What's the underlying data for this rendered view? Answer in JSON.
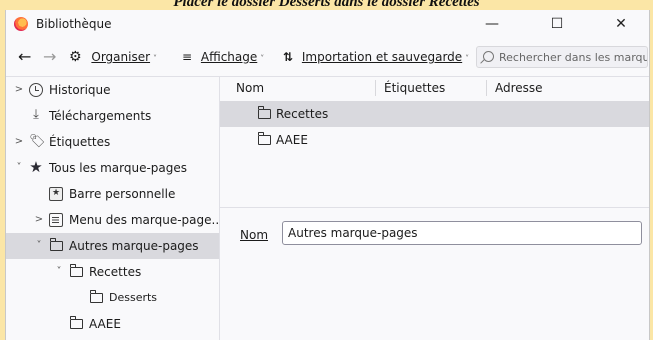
{
  "caption": "Placer le dossier Desserts dans le dossier Recettes",
  "window": {
    "title": "Bibliothèque",
    "minimize": "—",
    "maximize": "☐",
    "close": "✕"
  },
  "toolbar": {
    "back": "←",
    "forward": "→",
    "organize": {
      "icon": "⚙",
      "label": "Organiser"
    },
    "view": {
      "icon": "≡",
      "label": "Affichage"
    },
    "import": {
      "icon": "⇅",
      "label": "Importation et sauvegarde"
    },
    "caret": "˅",
    "search_placeholder": "Rechercher dans les marque-pages"
  },
  "sidebar": {
    "items": [
      {
        "label": "Historique",
        "twisty": ">",
        "icon": "clock-icon"
      },
      {
        "label": "Téléchargements",
        "twisty": "",
        "icon": "download-icon",
        "glyph": "⤓"
      },
      {
        "label": "Étiquettes",
        "twisty": ">",
        "icon": "tag-icon",
        "glyph": "🏷"
      },
      {
        "label": "Tous les marque-pages",
        "twisty": "˅",
        "icon": "star-icon",
        "glyph": "★"
      },
      {
        "label": "Barre personnelle",
        "twisty": "",
        "icon": "bookmarks-toolbar-icon",
        "glyph": "★"
      },
      {
        "label": "Menu des marque-page...",
        "twisty": ">",
        "icon": "bookmarks-menu-icon"
      },
      {
        "label": "Autres marque-pages",
        "twisty": "˅",
        "icon": "folder-icon"
      },
      {
        "label": "Recettes",
        "twisty": "˅",
        "icon": "folder-icon"
      },
      {
        "label": "Desserts",
        "twisty": "",
        "icon": "folder-icon"
      },
      {
        "label": "AAEE",
        "twisty": "",
        "icon": "folder-icon"
      }
    ]
  },
  "main": {
    "columns": [
      "Nom",
      "Étiquettes",
      "Adresse"
    ],
    "rows": [
      {
        "name": "Recettes"
      },
      {
        "name": "AAEE"
      }
    ],
    "details": {
      "name_label": "Nom",
      "name_value": "Autres marque-pages"
    }
  },
  "colors": {
    "selection": "#d9d9de",
    "background": "#fbe6a6"
  }
}
